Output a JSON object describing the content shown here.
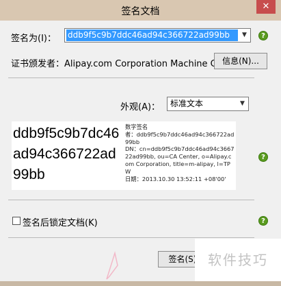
{
  "window": {
    "title": "签名文档",
    "close_glyph": "✕"
  },
  "sign_as": {
    "label": "签名为(I)：",
    "value": "ddb9f5c9b7ddc46ad94c366722ad99bb"
  },
  "issuer": {
    "label": "证书颁发者：Alipay.com Corporation Machine CA",
    "info_button": "信息(N)..."
  },
  "appearance": {
    "label": "外观(A)：",
    "value": "标准文本"
  },
  "preview": {
    "big_name": "ddb9f5c9b7dc46ad94c366722ad99bb",
    "detail_lines": [
      "数字签名",
      "者：ddb9f5c9b7ddc46ad94c366722ad99bb",
      "DN：cn=ddb9f5c9b7ddc46ad94c366722ad99bb, ou=CA Center, o=Alipay.com Corporation, title=m-alipay, l=TPW",
      "日期：2013.10.30 13:52:11 +08'00'"
    ]
  },
  "lock": {
    "label": "签名后锁定文档(K)",
    "checked": false
  },
  "sign_button": "签名(S)",
  "watermark": "软件技巧",
  "help_glyph": "?",
  "colors": {
    "help_green": "#5a9b1f",
    "selection_blue": "#3399ff",
    "close_red": "#c74d4d"
  }
}
